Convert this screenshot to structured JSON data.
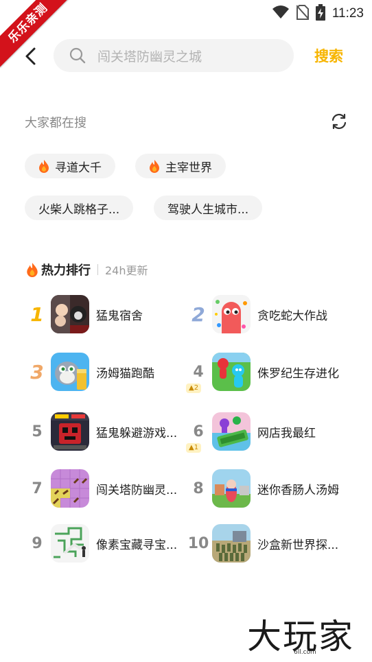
{
  "status_bar": {
    "time": "11:23"
  },
  "ribbon": {
    "text": "乐乐亲测"
  },
  "search": {
    "placeholder": "闯关塔防幽灵之城",
    "button": "搜索"
  },
  "hot": {
    "title": "大家都在搜",
    "chips": [
      {
        "label": "寻道大千",
        "hot": true
      },
      {
        "label": "主宰世界",
        "hot": true
      },
      {
        "label": "火柴人跳格子...",
        "hot": false
      },
      {
        "label": "驾驶人生城市...",
        "hot": false
      }
    ]
  },
  "ranking": {
    "title": "热力排行",
    "subtitle": "24h更新",
    "items": [
      {
        "rank": "1",
        "name": "猛鬼宿舍",
        "badge": ""
      },
      {
        "rank": "2",
        "name": "贪吃蛇大作战",
        "badge": ""
      },
      {
        "rank": "3",
        "name": "汤姆猫跑酷",
        "badge": ""
      },
      {
        "rank": "4",
        "name": "侏罗纪生存进化",
        "badge": "2"
      },
      {
        "rank": "5",
        "name": "猛鬼躲避游戏...",
        "badge": ""
      },
      {
        "rank": "6",
        "name": "网店我最红",
        "badge": "1"
      },
      {
        "rank": "7",
        "name": "闯关塔防幽灵...",
        "badge": ""
      },
      {
        "rank": "8",
        "name": "迷你香肠人汤姆",
        "badge": ""
      },
      {
        "rank": "9",
        "name": "像素宝藏寻宝...",
        "badge": ""
      },
      {
        "rank": "10",
        "name": "沙盒新世界探...",
        "badge": ""
      }
    ]
  },
  "watermark": {
    "logo_text": "大玩家",
    "url": "6ll.com"
  },
  "colors": {
    "accent": "#f7b500",
    "ribbon": "#d3121b",
    "chip_bg": "#f3f3f3"
  }
}
